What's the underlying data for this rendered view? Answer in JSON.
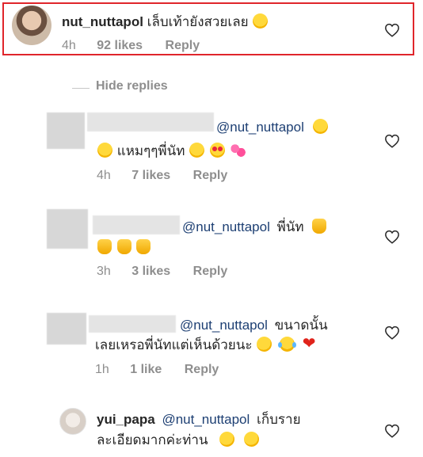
{
  "comments": [
    {
      "username": "nut_nuttapol",
      "text": "เล็บเท้ายังสวยเลย",
      "time": "4h",
      "likes": "92 likes",
      "reply": "Reply",
      "emoji": "laughing-face"
    }
  ],
  "hide_replies": "Hide replies",
  "replies": [
    {
      "mention": "@nut_nuttapol",
      "line2_text": "แหมๆๆพี่นัท",
      "time": "4h",
      "likes": "7 likes",
      "reply": "Reply",
      "emojis": [
        "grinning-face",
        "grinning-face",
        "laughing-face",
        "heart-eyes-face",
        "two-hearts"
      ]
    },
    {
      "mention": "@nut_nuttapol",
      "text_after_mention": "พี่นัท",
      "time": "3h",
      "likes": "3 likes",
      "reply": "Reply",
      "emojis": [
        "thumbs-up",
        "thumbs-up",
        "thumbs-up",
        "thumbs-up"
      ]
    },
    {
      "mention": "@nut_nuttapol",
      "text_after_mention": "ขนาดนั้น",
      "line2_text": "เลยเหรอพี่นัทแต่เห็นด้วยนะ",
      "time": "1h",
      "likes": "1 like",
      "reply": "Reply",
      "emojis": [
        "rofl-face",
        "joy-face",
        "red-heart"
      ]
    },
    {
      "username": "yui_papa",
      "mention": "@nut_nuttapol",
      "text_after_mention": "เก็บราย",
      "line2_text": "ละเอียดมากค่ะท่าน",
      "emojis": [
        "rofl-face",
        "rofl-face"
      ]
    }
  ],
  "colors": {
    "highlight_border": "#e0252b",
    "mention": "#1d3f73",
    "meta": "#8e8e8e",
    "text": "#262626"
  },
  "icons": {
    "like": "heart-outline-icon"
  }
}
